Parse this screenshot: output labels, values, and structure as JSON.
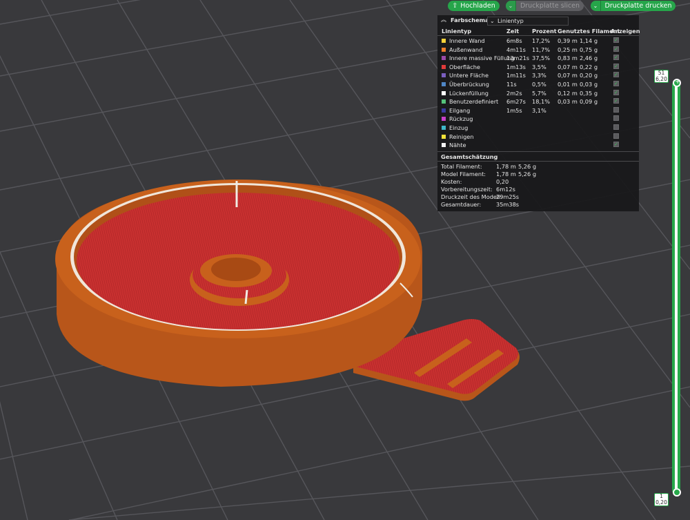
{
  "toolbar": {
    "upload_label": "Hochladen",
    "slice_label": "Druckplatte slicen",
    "print_label": "Druckplatte drucken"
  },
  "legend": {
    "title": "Farbschema",
    "scheme_value": "Linientyp",
    "columns": [
      "Linientyp",
      "Zeit",
      "Prozent",
      "Genutztes Filament",
      "Anzeigen"
    ],
    "rows": [
      {
        "name": "Innere Wand",
        "color": "#f7d23a",
        "time": "6m8s",
        "percent": "17,2%",
        "meters": "0,39 m",
        "grams": "1,14 g",
        "visible": true
      },
      {
        "name": "Außenwand",
        "color": "#f07d2a",
        "time": "4m11s",
        "percent": "11,7%",
        "meters": "0,25 m",
        "grams": "0,75 g",
        "visible": true
      },
      {
        "name": "Innere massive Füllung",
        "color": "#9b4aa8",
        "time": "13m21s",
        "percent": "37,5%",
        "meters": "0,83 m",
        "grams": "2,46 g",
        "visible": true
      },
      {
        "name": "Oberfläche",
        "color": "#e03a3a",
        "time": "1m13s",
        "percent": "3,5%",
        "meters": "0,07 m",
        "grams": "0,22 g",
        "visible": true
      },
      {
        "name": "Untere Fläche",
        "color": "#7a5fc0",
        "time": "1m11s",
        "percent": "3,3%",
        "meters": "0,07 m",
        "grams": "0,20 g",
        "visible": true
      },
      {
        "name": "Überbrückung",
        "color": "#4f86c6",
        "time": "11s",
        "percent": "0,5%",
        "meters": "0,01 m",
        "grams": "0,03 g",
        "visible": true
      },
      {
        "name": "Lückenfüllung",
        "color": "#ffffff",
        "time": "2m2s",
        "percent": "5,7%",
        "meters": "0,12 m",
        "grams": "0,35 g",
        "visible": true
      },
      {
        "name": "Benutzerdefiniert",
        "color": "#55c27a",
        "time": "6m27s",
        "percent": "18,1%",
        "meters": "0,03 m",
        "grams": "0,09 g",
        "visible": true
      },
      {
        "name": "Eilgang",
        "color": "#3a3aa0",
        "time": "1m5s",
        "percent": "3,1%",
        "meters": "",
        "grams": "",
        "visible": false
      },
      {
        "name": "Rückzug",
        "color": "#c93fc9",
        "time": "",
        "percent": "",
        "meters": "",
        "grams": "",
        "visible": false
      },
      {
        "name": "Einzug",
        "color": "#3fb8c9",
        "time": "",
        "percent": "",
        "meters": "",
        "grams": "",
        "visible": false
      },
      {
        "name": "Reinigen",
        "color": "#f2e23a",
        "time": "",
        "percent": "",
        "meters": "",
        "grams": "",
        "visible": false
      },
      {
        "name": "Nähte",
        "color": "#f2f2f2",
        "time": "",
        "percent": "",
        "meters": "",
        "grams": "",
        "visible": true
      }
    ],
    "estimate_title": "Gesamtschätzung",
    "estimates": [
      {
        "label": "Total Filament:",
        "v1": "1,78 m",
        "v2": "5,26 g"
      },
      {
        "label": "Model Filament:",
        "v1": "1,78 m",
        "v2": "5,26 g"
      },
      {
        "label": "Kosten:",
        "v1": "0,20",
        "v2": ""
      },
      {
        "label": "Vorbereitungszeit:",
        "v1": "6m12s",
        "v2": ""
      },
      {
        "label": "Druckzeit des Modell:",
        "v1": "29m25s",
        "v2": ""
      },
      {
        "label": "Gesamtdauer:",
        "v1": "35m38s",
        "v2": ""
      }
    ]
  },
  "slider": {
    "top_layer": "51",
    "top_height": "6,20",
    "bottom_layer": "1",
    "bottom_height": "0,20"
  },
  "colors": {
    "plate": "#39393c",
    "grid": "#55555a",
    "model_orange": "#c8611c",
    "top_surface": "#c43232",
    "accent_green": "#27a84a"
  }
}
